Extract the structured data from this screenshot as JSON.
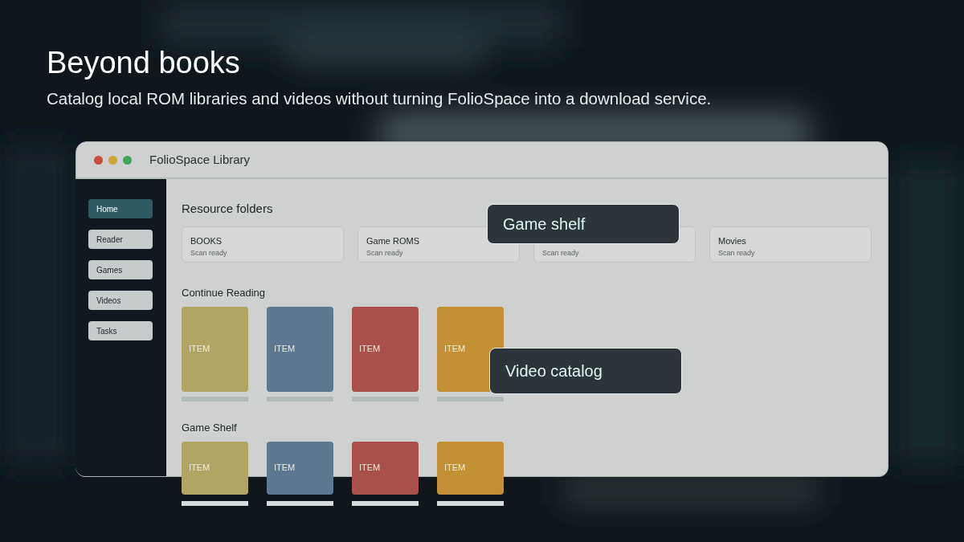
{
  "hero": {
    "title": "Beyond books",
    "subtitle": "Catalog local ROM libraries and videos without turning FolioSpace into a download service."
  },
  "window": {
    "title": "FolioSpace Library"
  },
  "sidebar": {
    "items": [
      {
        "label": "Home",
        "selected": true
      },
      {
        "label": "Reader",
        "selected": false
      },
      {
        "label": "Games",
        "selected": false
      },
      {
        "label": "Videos",
        "selected": false
      },
      {
        "label": "Tasks",
        "selected": false
      }
    ]
  },
  "resource_folders": {
    "heading": "Resource folders",
    "folders": [
      {
        "name": "BOOKS",
        "status": "Scan ready"
      },
      {
        "name": "Game ROMS",
        "status": "Scan ready"
      },
      {
        "status": "Scan ready"
      },
      {
        "name": "Movies",
        "status": "Scan ready"
      }
    ]
  },
  "sections": [
    {
      "heading": "Continue Reading",
      "items": [
        {
          "label": "ITEM",
          "color": "#b0a562"
        },
        {
          "label": "ITEM",
          "color": "#5e7891"
        },
        {
          "label": "ITEM",
          "color": "#a9504d"
        },
        {
          "label": "ITEM",
          "color": "#c39035"
        }
      ]
    },
    {
      "heading": "Game Shelf",
      "items": [
        {
          "label": "ITEM",
          "color": "#b0a562"
        },
        {
          "label": "ITEM",
          "color": "#5e7891"
        },
        {
          "label": "ITEM",
          "color": "#a9504d"
        },
        {
          "label": "ITEM",
          "color": "#c39035"
        }
      ]
    }
  ],
  "callouts": [
    {
      "label": "Game shelf"
    },
    {
      "label": "Video catalog"
    }
  ]
}
